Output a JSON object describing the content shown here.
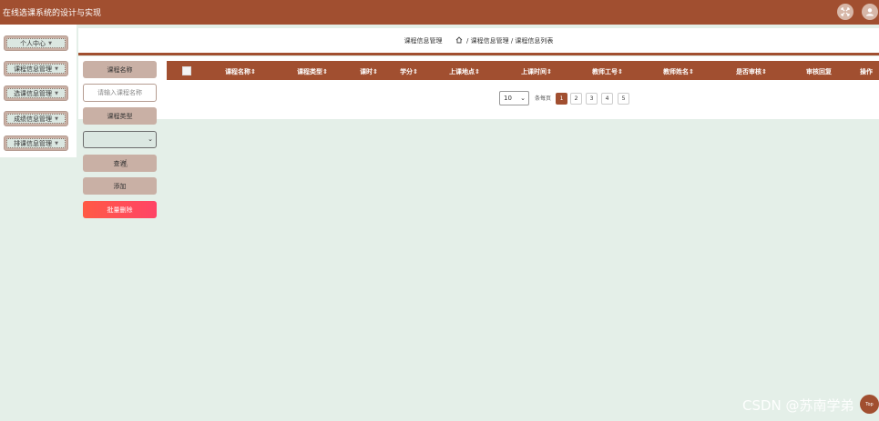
{
  "app": {
    "title": "在线选课系统的设计与实现"
  },
  "topbar": {
    "fullscreen_icon": "fullscreen-icon",
    "user_icon": "user-avatar-icon"
  },
  "sidebar": {
    "items": [
      {
        "label": "个人中心"
      },
      {
        "label": "课程信息管理"
      },
      {
        "label": "选课信息管理"
      },
      {
        "label": "成绩信息管理"
      },
      {
        "label": "排课信息管理"
      }
    ]
  },
  "breadcrumb": {
    "page_title": "课程信息管理",
    "home_icon": "home-icon",
    "trail": "/ 课程信息管理 / 课程信息列表"
  },
  "search": {
    "name_label": "课程名称",
    "name_placeholder": "请输入课程名称",
    "type_label": "课程类型",
    "type_value": "",
    "query_button": "查询",
    "add_button": "添加",
    "batch_delete_button": "批量删除"
  },
  "table": {
    "columns": [
      "课程名称",
      "课程类型",
      "课时",
      "学分",
      "上课地点",
      "上课时间",
      "教师工号",
      "教师姓名",
      "是否审核",
      "审核回复",
      "操作"
    ],
    "rows": []
  },
  "pagination": {
    "page_size": "10",
    "page_size_suffix": "条每页",
    "pages": [
      "1",
      "2",
      "3",
      "4",
      "5"
    ],
    "current_page": "1"
  },
  "watermark": "CSDN @苏南学弟",
  "back_to_top": "Top",
  "colors": {
    "brand": "#a14f30",
    "button": "#c9b0a5",
    "danger": "#ff4f55",
    "background": "#e4efe8"
  }
}
